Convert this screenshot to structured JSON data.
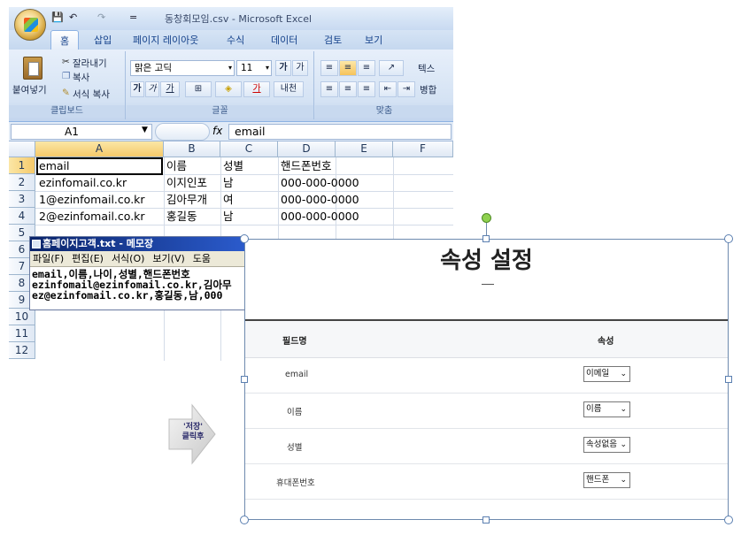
{
  "excel": {
    "window_title": "동창회모임.csv - Microsoft Excel",
    "qat": [
      "💾",
      "↶",
      "↷",
      "="
    ],
    "tabs": [
      "홈",
      "삽입",
      "페이지 레이아웃",
      "수식",
      "데이터",
      "검토",
      "보기"
    ],
    "ribbon": {
      "paste_label": "붙여넣기",
      "cut_label": "잘라내기",
      "copy_label": "복사",
      "format_painter_label": "서식 복사",
      "clipboard_group": "클립보드",
      "font_name": "맑은 고딕",
      "font_size": "11",
      "font_group": "글꼴",
      "alignment_group": "맞춤",
      "wrap_text_label": "텍스",
      "merge_label": "병합"
    },
    "name_box": "A1",
    "formula_value": "email",
    "columns": [
      "A",
      "B",
      "C",
      "D",
      "E",
      "F"
    ],
    "rows": [
      "1",
      "2",
      "3",
      "4",
      "5",
      "6",
      "7",
      "8",
      "9",
      "10",
      "11",
      "12"
    ],
    "cells": [
      [
        "email",
        "이름",
        "성별",
        "핸드폰번호"
      ],
      [
        "ezinfomail.co.kr",
        "이지인포",
        "남",
        "000-000-0000"
      ],
      [
        "1@ezinfomail.co.kr",
        "김아무개",
        "여",
        "000-000-0000"
      ],
      [
        "2@ezinfomail.co.kr",
        "홍길동",
        "남",
        "000-000-0000"
      ]
    ]
  },
  "notepad": {
    "title": "홈페이지고객.txt - 메모장",
    "menu": [
      "파일(F)",
      "편집(E)",
      "서식(O)",
      "보기(V)",
      "도움"
    ],
    "lines": [
      "email,이름,나이,성별,핸드폰번호",
      "ezinfomail@ezinfomail.co.kr,김아무",
      "ez@ezinfomail.co.kr,홍길동,남,000"
    ]
  },
  "arrow": {
    "line1": "'저장'",
    "line2": "클릭후"
  },
  "dialog": {
    "title": "속성 설정",
    "header_field": "필드명",
    "header_attr": "속성",
    "rows": [
      {
        "field": "email",
        "value": "이메일"
      },
      {
        "field": "이름",
        "value": "이름"
      },
      {
        "field": "성별",
        "value": "속성없음"
      },
      {
        "field": "휴대폰번호",
        "value": "핸드폰"
      }
    ]
  }
}
